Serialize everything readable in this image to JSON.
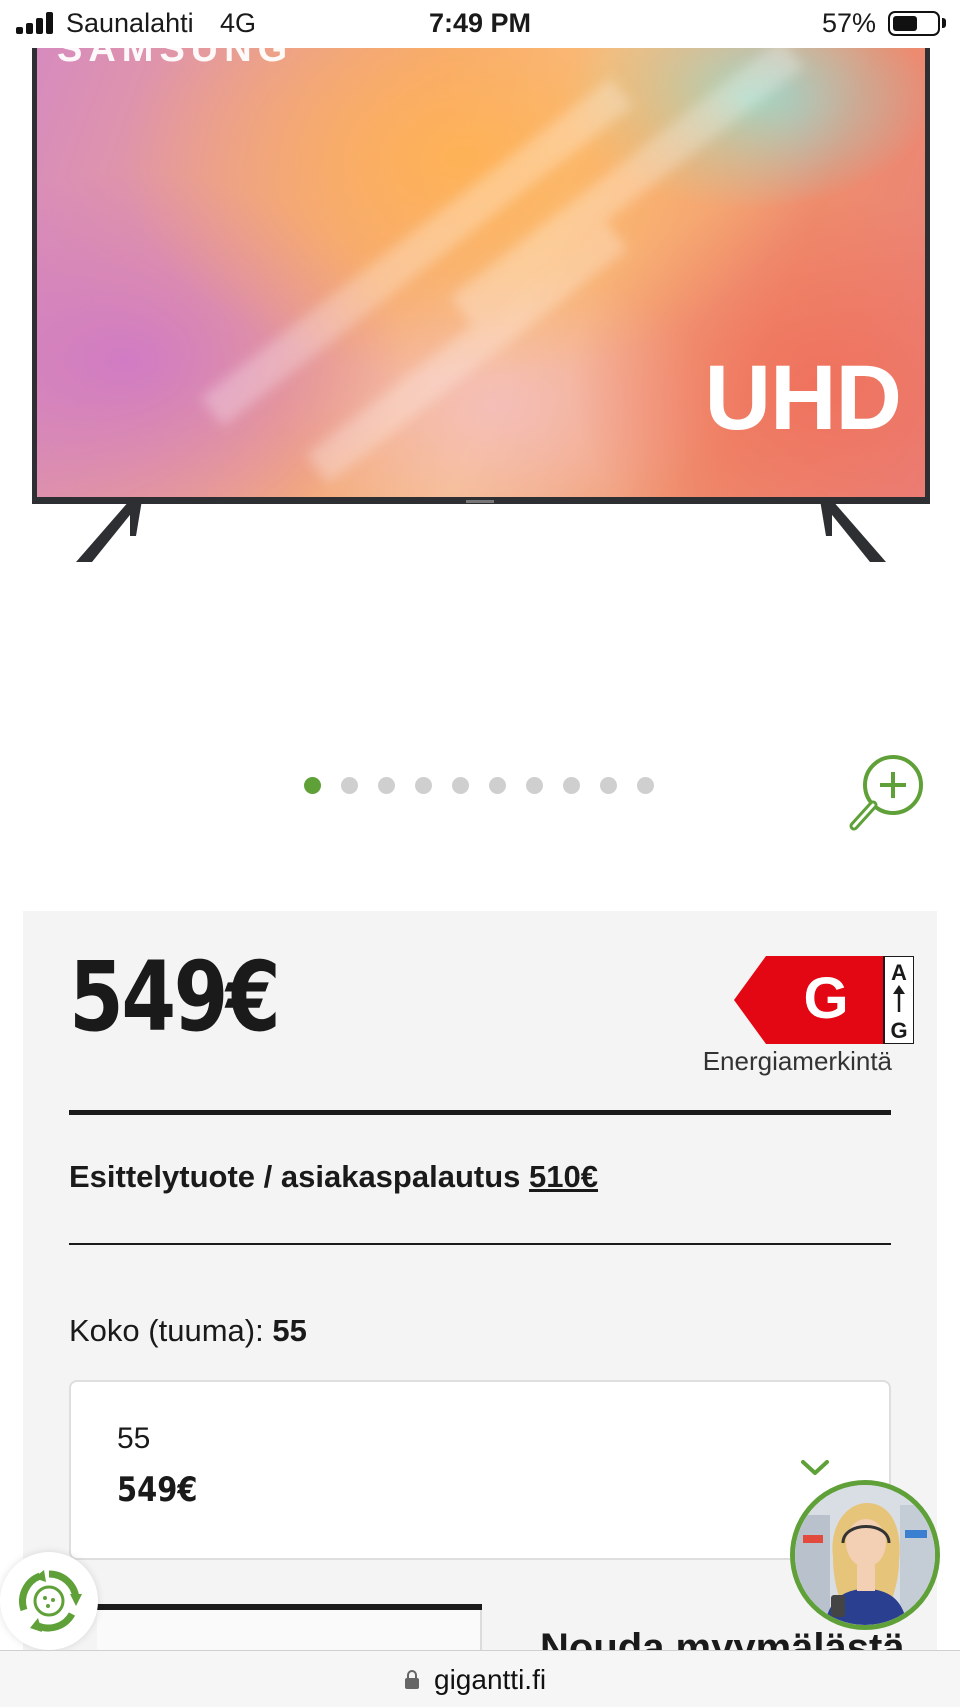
{
  "status_bar": {
    "carrier": "Saunalahti",
    "network": "4G",
    "time": "7:49 PM",
    "battery_percent": "57%",
    "battery_level": 0.57
  },
  "product_image": {
    "brand_text": "SAMSUNG",
    "badge_text": "UHD",
    "icon": "tv-product-photo"
  },
  "carousel": {
    "slide_count": 10,
    "active_index": 0,
    "active_color": "#5fa138",
    "inactive_color": "#cfcfcf",
    "zoom_icon": "zoom-in-icon"
  },
  "price": {
    "current": "549€"
  },
  "energy": {
    "class_letter": "G",
    "scale_top": "A",
    "scale_bottom": "G",
    "caption": "Energiamerkintä",
    "label_color": "#e30613"
  },
  "demo_offer": {
    "label": "Esittelytuote / asiakaspalautus",
    "price": "510€"
  },
  "size": {
    "label": "Koko (tuuma):",
    "value": "55",
    "selected_option": {
      "size": "55",
      "price": "549€"
    },
    "chevron_icon": "chevron-down-icon"
  },
  "pickup": {
    "heading": "Nouda myymälästä"
  },
  "floating": {
    "recycle_icon": "recycle-icon",
    "chat_avatar": "customer-service-avatar"
  },
  "browser": {
    "domain": "gigantti.fi",
    "lock_icon": "lock-icon"
  },
  "colors": {
    "brand_green": "#5fa138",
    "panel_bg": "#f4f4f4",
    "text": "#1a1a1a"
  }
}
